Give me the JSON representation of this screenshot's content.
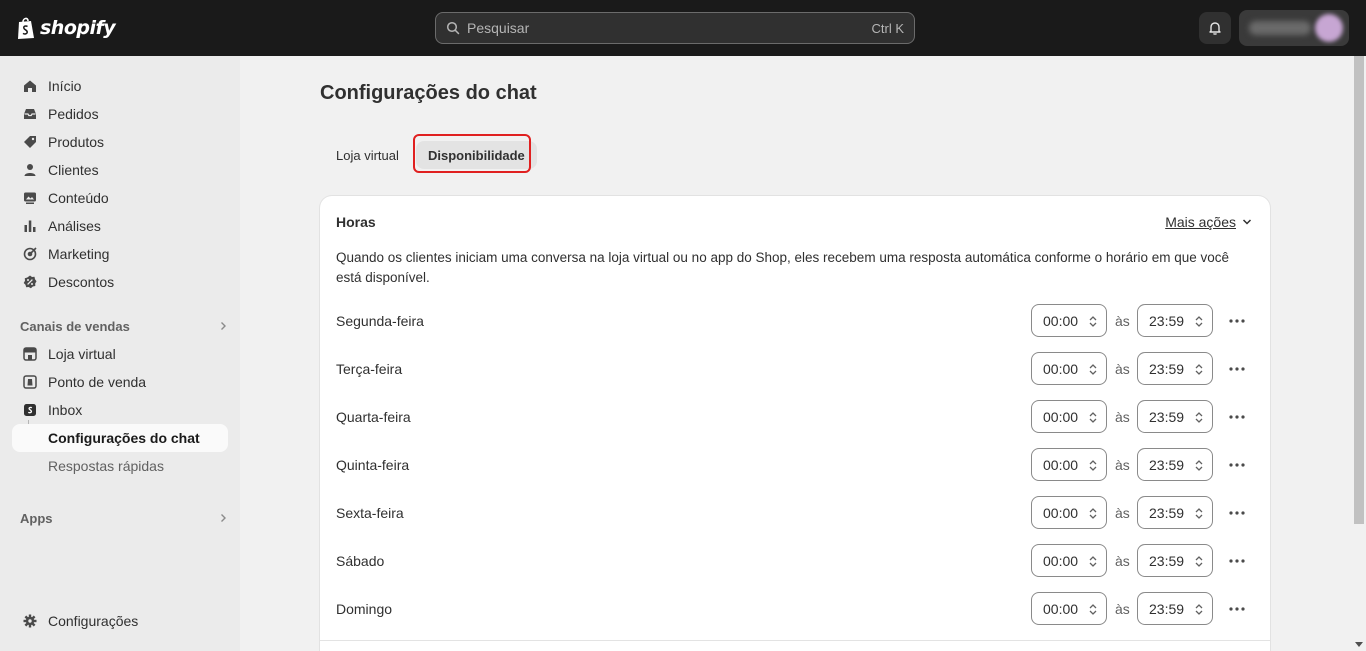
{
  "topbar": {
    "brand": "shopify",
    "search_placeholder": "Pesquisar",
    "search_shortcut": "Ctrl K"
  },
  "sidebar": {
    "items": [
      {
        "label": "Início",
        "icon": "home-icon"
      },
      {
        "label": "Pedidos",
        "icon": "inbox-tray-icon"
      },
      {
        "label": "Produtos",
        "icon": "tag-icon"
      },
      {
        "label": "Clientes",
        "icon": "person-icon"
      },
      {
        "label": "Conteúdo",
        "icon": "image-icon"
      },
      {
        "label": "Análises",
        "icon": "bar-chart-icon"
      },
      {
        "label": "Marketing",
        "icon": "target-icon"
      },
      {
        "label": "Descontos",
        "icon": "discount-icon"
      }
    ],
    "sales_channels_title": "Canais de vendas",
    "channels": [
      {
        "label": "Loja virtual",
        "icon": "storefront-icon"
      },
      {
        "label": "Ponto de venda",
        "icon": "pos-icon"
      },
      {
        "label": "Inbox",
        "icon": "shopify-bag-icon"
      }
    ],
    "sub_items": [
      {
        "label": "Configurações do chat",
        "active": true
      },
      {
        "label": "Respostas rápidas",
        "active": false
      }
    ],
    "apps_title": "Apps",
    "settings_label": "Configurações"
  },
  "main": {
    "title": "Configurações do chat",
    "tabs": [
      {
        "label": "Loja virtual",
        "selected": false
      },
      {
        "label": "Disponibilidade",
        "selected": true
      }
    ],
    "card": {
      "title": "Horas",
      "more_actions": "Mais ações",
      "description": "Quando os clientes iniciam uma conversa na loja virtual ou no app do Shop, eles recebem uma resposta automática conforme o horário em que você está disponível.",
      "connector": "às",
      "days": [
        {
          "day": "Segunda-feira",
          "start": "00:00",
          "end": "23:59"
        },
        {
          "day": "Terça-feira",
          "start": "00:00",
          "end": "23:59"
        },
        {
          "day": "Quarta-feira",
          "start": "00:00",
          "end": "23:59"
        },
        {
          "day": "Quinta-feira",
          "start": "00:00",
          "end": "23:59"
        },
        {
          "day": "Sexta-feira",
          "start": "00:00",
          "end": "23:59"
        },
        {
          "day": "Sábado",
          "start": "00:00",
          "end": "23:59"
        },
        {
          "day": "Domingo",
          "start": "00:00",
          "end": "23:59"
        }
      ]
    }
  },
  "colors": {
    "topbar_bg": "#1a1a1a",
    "sidebar_bg": "#ebebeb",
    "page_bg": "#f1f1f1",
    "highlight_border": "#e02020"
  }
}
